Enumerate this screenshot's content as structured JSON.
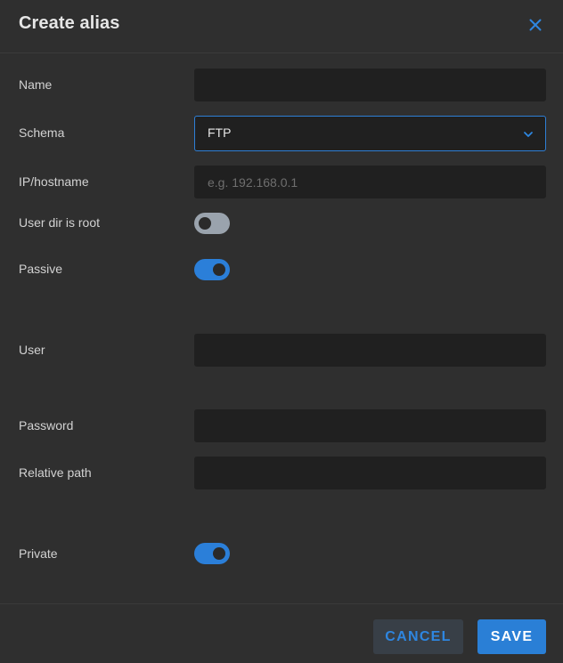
{
  "dialog": {
    "title": "Create alias"
  },
  "fields": {
    "name": {
      "label": "Name",
      "value": ""
    },
    "schema": {
      "label": "Schema",
      "value": "FTP"
    },
    "hostname": {
      "label": "IP/hostname",
      "value": "",
      "placeholder": "e.g. 192.168.0.1"
    },
    "user_dir_root": {
      "label": "User dir is root",
      "checked": false
    },
    "passive": {
      "label": "Passive",
      "checked": true
    },
    "user": {
      "label": "User",
      "value": ""
    },
    "password": {
      "label": "Password",
      "value": ""
    },
    "relative_path": {
      "label": "Relative path",
      "value": ""
    },
    "private": {
      "label": "Private",
      "checked": true
    }
  },
  "actions": {
    "cancel_label": "CANCEL",
    "save_label": "SAVE"
  },
  "icons": {
    "close": "close-icon",
    "chevron": "chevron-down-icon"
  },
  "colors": {
    "accent": "#2b7fd9",
    "background": "#2f2f2f",
    "field_bg": "#202020"
  }
}
